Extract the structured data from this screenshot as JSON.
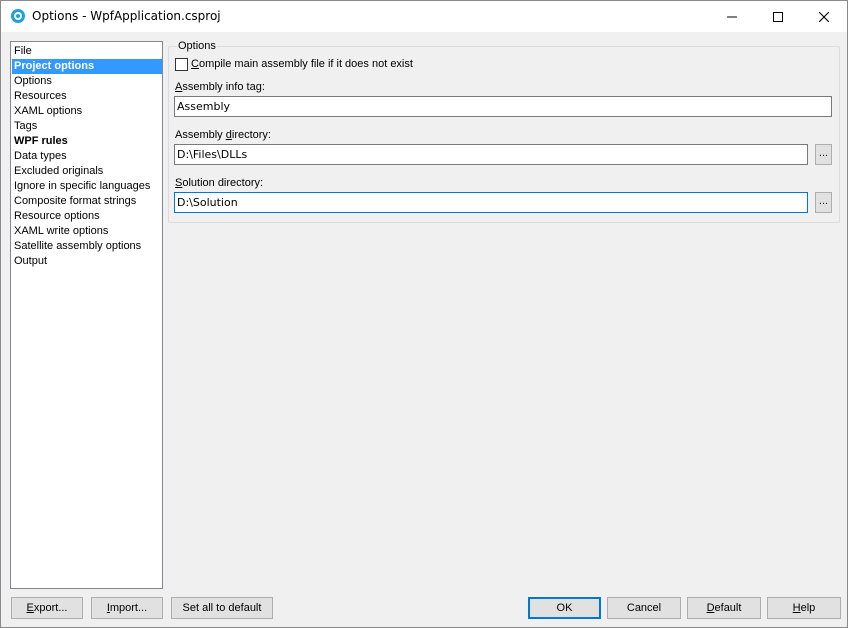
{
  "window": {
    "title": "Options - WpfApplication.csproj"
  },
  "tree": {
    "items": [
      {
        "label": "File"
      },
      {
        "label": "Project options"
      },
      {
        "label": "Options"
      },
      {
        "label": "Resources"
      },
      {
        "label": "XAML options"
      },
      {
        "label": "Tags"
      },
      {
        "label": "WPF rules"
      },
      {
        "label": "Data types"
      },
      {
        "label": "Excluded originals"
      },
      {
        "label": "Ignore in specific languages"
      },
      {
        "label": "Composite format strings"
      },
      {
        "label": "Resource options"
      },
      {
        "label": "XAML write options"
      },
      {
        "label": "Satellite assembly options"
      },
      {
        "label": "Output"
      }
    ],
    "selected": "Project options"
  },
  "options": {
    "group_title": "Options",
    "compile_label_key": "C",
    "compile_label_rest": "ompile main assembly file if it does not exist",
    "assembly_info_key": "A",
    "assembly_info_rest": "ssembly info tag:",
    "assembly_info_value": "Assembly",
    "assembly_dir_pre": "Assembly ",
    "assembly_dir_key": "d",
    "assembly_dir_post": "irectory:",
    "assembly_dir_value": "D:\\Files\\DLLs",
    "solution_dir_key": "S",
    "solution_dir_rest": "olution directory:",
    "solution_dir_value": "D:\\Solution",
    "browse_label": "..."
  },
  "buttons": {
    "export_key": "E",
    "export_rest": "xport...",
    "import_key": "I",
    "import_rest": "mport...",
    "set_all": "Set all to default",
    "ok": "OK",
    "cancel": "Cancel",
    "default_key": "D",
    "default_rest": "efault",
    "help_key": "H",
    "help_rest": "elp"
  }
}
